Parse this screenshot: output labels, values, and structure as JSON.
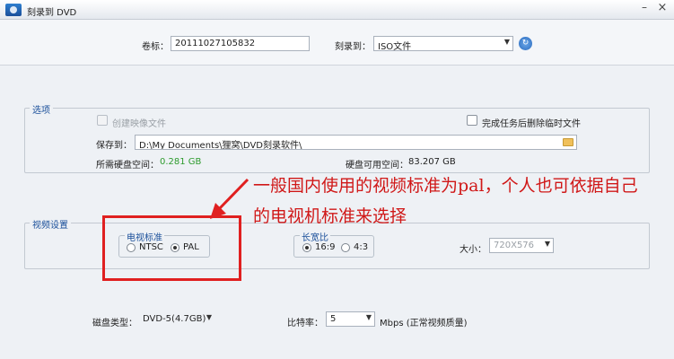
{
  "window": {
    "title": "刻录到 DVD",
    "minimize": "–",
    "close": "×"
  },
  "header": {
    "volume_label": "卷标：",
    "volume_value": "20111027105832",
    "burn_to_label": "刻录到：",
    "burn_to_value": "ISO文件",
    "refresh": "↻"
  },
  "options": {
    "title": "选项",
    "create_image": "创建映像文件",
    "delete_temp": "完成任务后删除临时文件",
    "save_to_label": "保存到：",
    "save_to_value": "D:\\My Documents\\狸窝\\DVD刻录软件\\",
    "space_needed_label": "所需硬盘空间：",
    "space_needed_value": "0.281 GB",
    "space_available_label": "硬盘可用空间：",
    "space_available_value": "83.207 GB"
  },
  "video": {
    "title": "视频设置",
    "standard_title": "电视标准",
    "ntsc": "NTSC",
    "pal": "PAL",
    "standard_selected": "PAL",
    "aspect_title": "长宽比",
    "ratio_169": "16:9",
    "ratio_43": "4:3",
    "aspect_selected": "16:9",
    "size_label": "大小：",
    "size_value": "720X576"
  },
  "footer": {
    "disc_type_label": "磁盘类型：",
    "disc_type_value": "DVD-5(4.7GB)",
    "bitrate_label": "比特率：",
    "bitrate_value": "5",
    "bitrate_unit": "Mbps (正常视频质量)"
  },
  "annotation": {
    "line1": "一般国内使用的视频标准为pal，个人也可依据自己",
    "line2": "的电视机标准来选择",
    "color": "#d01818"
  }
}
